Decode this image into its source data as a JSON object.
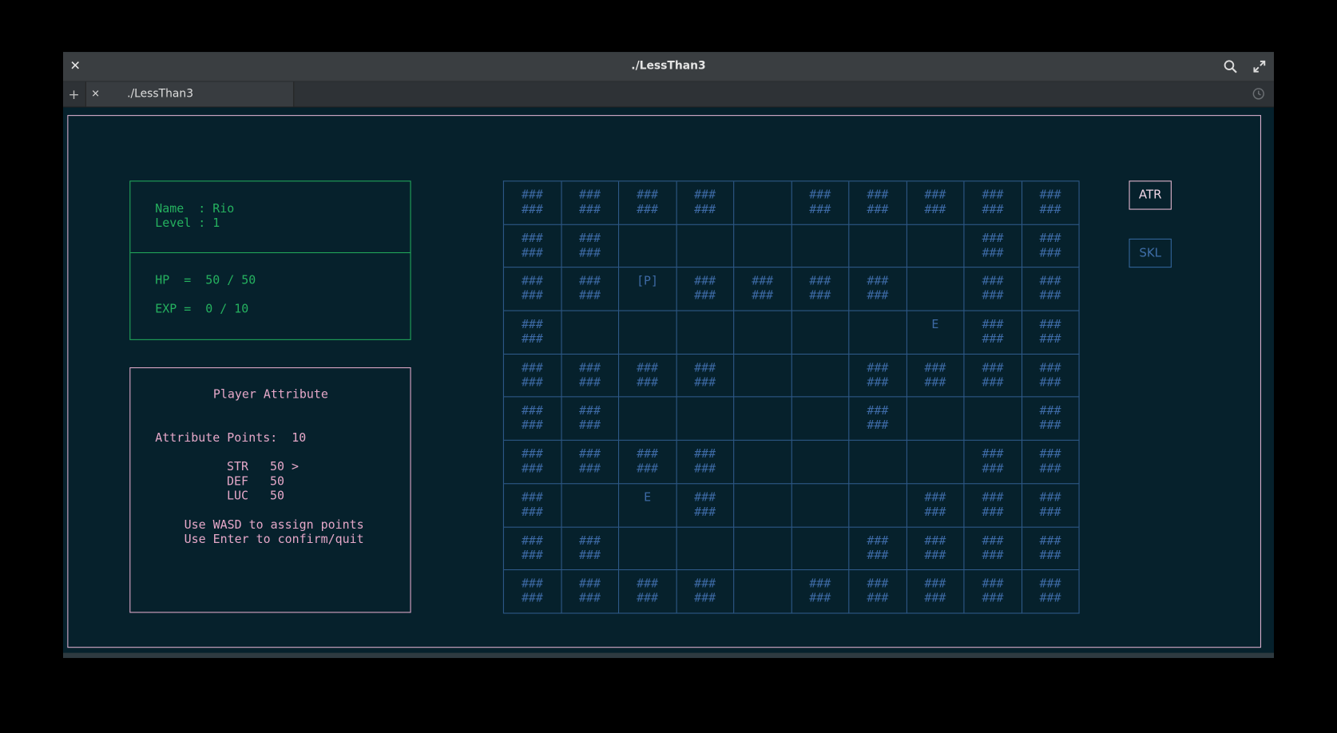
{
  "window": {
    "title": "./LessThan3",
    "close_glyph": "✕",
    "icons": [
      "search-icon",
      "expand-icon",
      "history-icon"
    ]
  },
  "tabs": {
    "new_tab_glyph": "+",
    "close_glyph": "✕",
    "items": [
      {
        "label": "./LessThan3"
      }
    ]
  },
  "stats": {
    "name_line": "Name  : Rio",
    "level_line": "Level : 1",
    "hp_line": "HP  =  50 / 50",
    "exp_line": "EXP =  0 / 10"
  },
  "attributes": {
    "title": "Player Attribute",
    "points_line": "Attribute Points:  10",
    "str_line": "STR   50 >",
    "def_line": "DEF   50",
    "luc_line": "LUC   50",
    "help1": "Use WASD to assign points",
    "help2": "Use Enter to confirm/quit"
  },
  "map": {
    "wall": "###\n###",
    "rows": [
      [
        "#",
        "#",
        "#",
        "#",
        " ",
        "#",
        "#",
        "#",
        "#",
        "#"
      ],
      [
        "#",
        "#",
        " ",
        " ",
        " ",
        " ",
        " ",
        " ",
        "#",
        "#"
      ],
      [
        "#",
        "#",
        "[P]",
        "#",
        "#",
        "#",
        "#",
        " ",
        "#",
        "#"
      ],
      [
        "#",
        " ",
        " ",
        " ",
        " ",
        " ",
        " ",
        "E",
        "#",
        "#"
      ],
      [
        "#",
        "#",
        "#",
        "#",
        " ",
        " ",
        "#",
        "#",
        "#",
        "#"
      ],
      [
        "#",
        "#",
        " ",
        " ",
        " ",
        " ",
        "#",
        " ",
        " ",
        "#"
      ],
      [
        "#",
        "#",
        "#",
        "#",
        " ",
        " ",
        " ",
        " ",
        "#",
        "#"
      ],
      [
        "#",
        " ",
        "E",
        "#",
        " ",
        " ",
        " ",
        "#",
        "#",
        "#"
      ],
      [
        "#",
        "#",
        " ",
        " ",
        " ",
        " ",
        "#",
        "#",
        "#",
        "#"
      ],
      [
        "#",
        "#",
        "#",
        "#",
        " ",
        "#",
        "#",
        "#",
        "#",
        "#"
      ]
    ]
  },
  "side_menu": {
    "atr_label": "ATR",
    "skl_label": "SKL",
    "selected": "ATR"
  },
  "colors": {
    "background": "#06212c",
    "green": "#25b15f",
    "pink": "#e6a8c9",
    "grid_blue": "#3d6aa5"
  }
}
